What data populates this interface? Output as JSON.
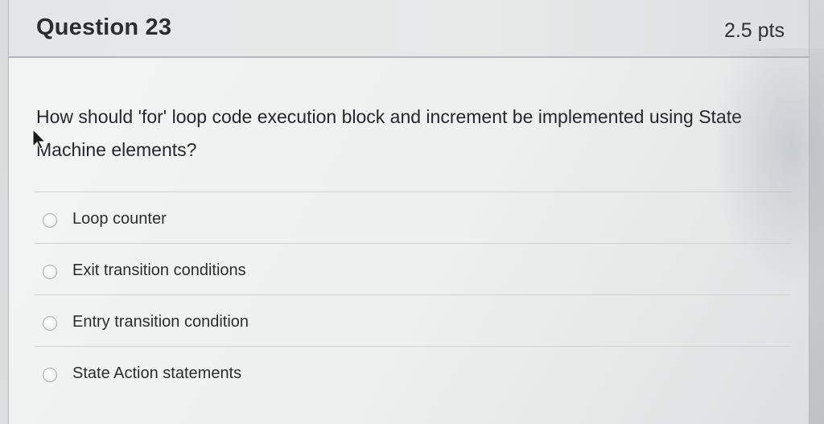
{
  "question": {
    "title": "Question 23",
    "points": "2.5 pts",
    "text": "How should 'for' loop code execution block and increment be implemented using State Machine elements?"
  },
  "answers": [
    {
      "label": "Loop counter",
      "selected": false
    },
    {
      "label": "Exit transition conditions",
      "selected": false
    },
    {
      "label": "Entry transition condition",
      "selected": false
    },
    {
      "label": "State Action statements",
      "selected": false
    }
  ],
  "icons": {
    "cursor": "mouse-pointer-icon",
    "radio": "radio-button-icon"
  }
}
